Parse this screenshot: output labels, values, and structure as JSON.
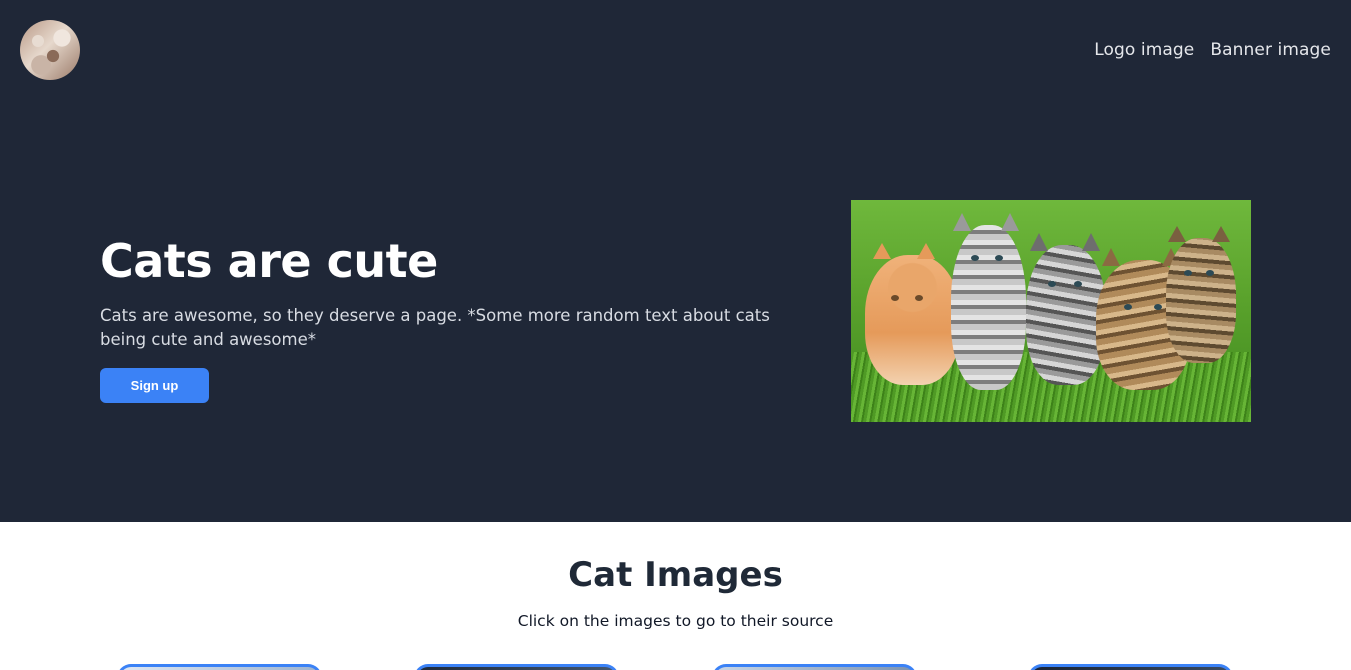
{
  "nav": {
    "logo_image": "Logo image",
    "banner_image": "Banner image"
  },
  "hero": {
    "title": "Cats are cute",
    "text": "Cats are awesome, so they deserve a page. *Some more random text about cats being cute and awesome*",
    "signup_label": "Sign up"
  },
  "gallery": {
    "title": "Cat Images",
    "subtitle": "Click on the images to go to their source",
    "card_count": 4
  },
  "colors": {
    "hero_bg": "#1f2737",
    "accent": "#3b82f6",
    "heading_dark": "#1f2937"
  },
  "icons": {
    "logo": "cat-logo-image",
    "banner": "kittens-banner-image"
  }
}
